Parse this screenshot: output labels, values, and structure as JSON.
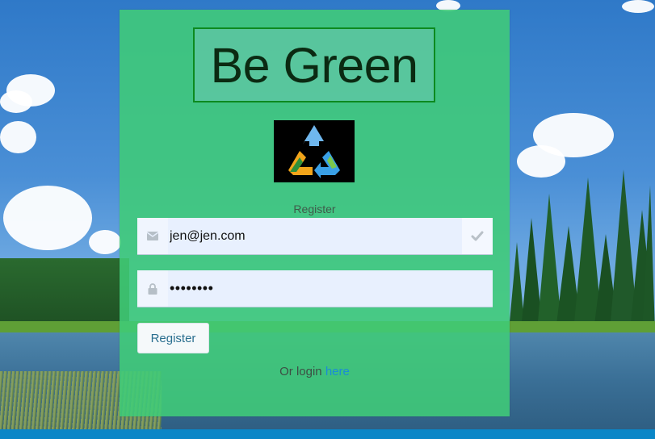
{
  "app": {
    "title": "Be Green"
  },
  "logo": {
    "icon": "recycle-icon"
  },
  "form": {
    "heading": "Register",
    "email": {
      "value": "jen@jen.com",
      "icon": "envelope-icon",
      "status_icon": "checkmark-icon"
    },
    "password": {
      "value": "••••••••",
      "icon": "lock-icon"
    },
    "submit_label": "Register"
  },
  "footer": {
    "prefix": "Or login",
    "link_label": "here"
  },
  "colors": {
    "panel": "#40cc78",
    "title_border": "#0c8a1f",
    "link": "#1a8cd8",
    "button_text": "#2a6f8f"
  }
}
